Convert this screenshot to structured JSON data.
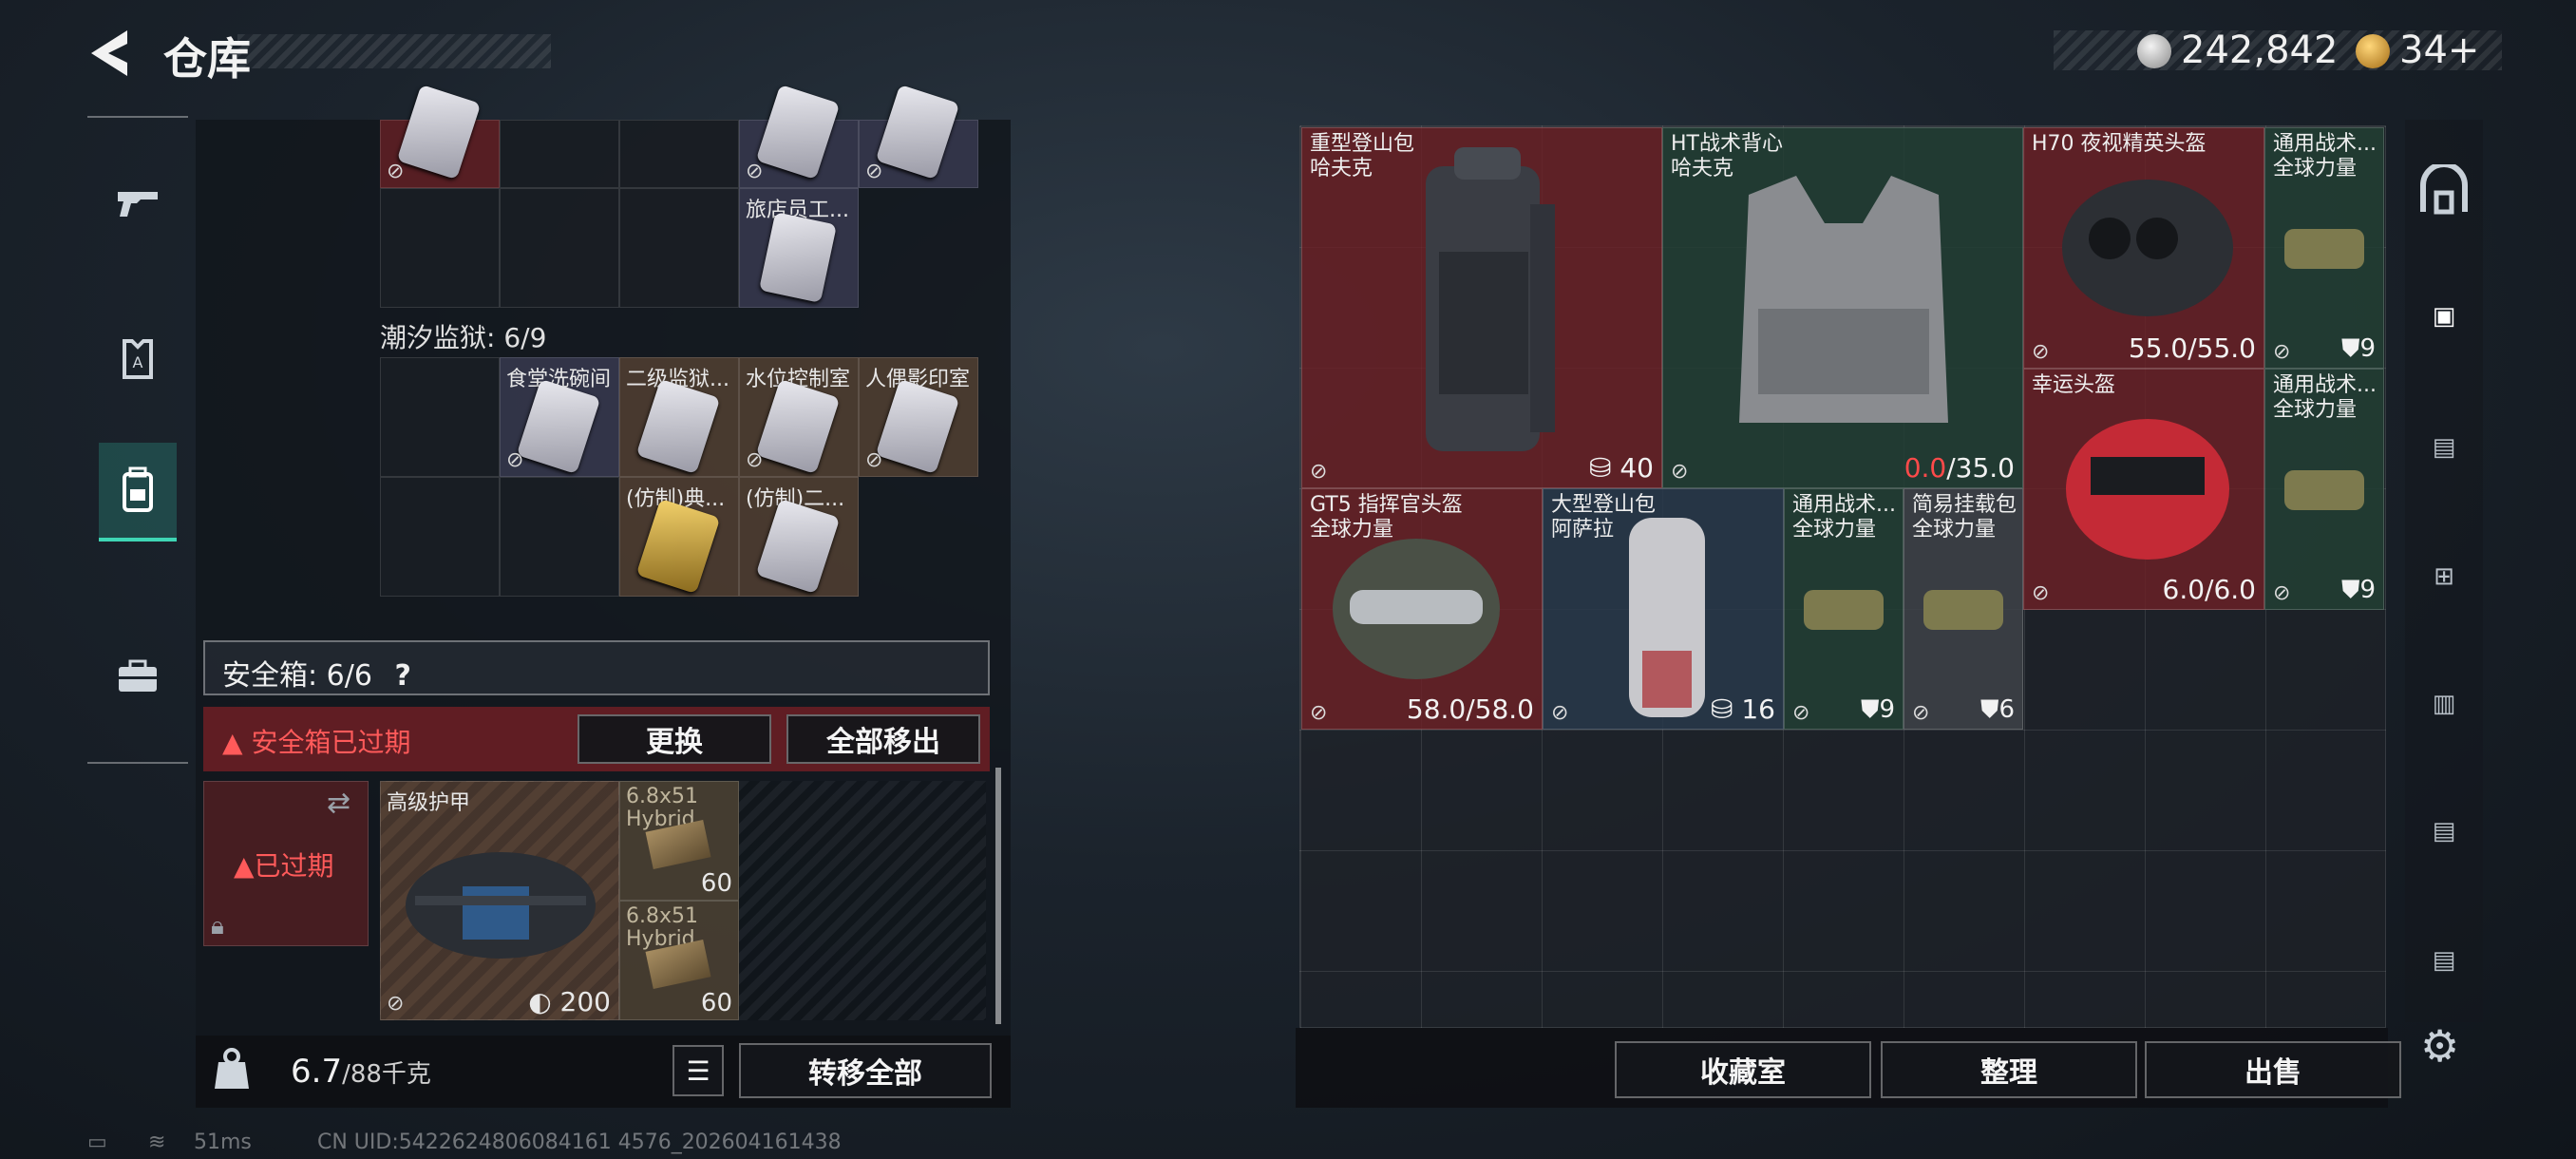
{
  "header": {
    "title": "仓库",
    "currency_silver": "242,842",
    "currency_gold": "34+"
  },
  "left_panel": {
    "top_row_items": [
      {
        "label": "旅店员工..."
      }
    ],
    "section_title": "潮汐监狱: 6/9",
    "keycards": [
      {
        "label": "食堂洗碗间"
      },
      {
        "label": "二级监狱..."
      },
      {
        "label": "水位控制室"
      },
      {
        "label": "人偶影印室"
      },
      {
        "label": "(仿制)典..."
      },
      {
        "label": "(仿制)二..."
      }
    ],
    "safebox_label": "安全箱: 6/6",
    "safebox_help": "?",
    "expired_warning": "安全箱已过期",
    "replace_button": "更换",
    "move_all_out_button": "全部移出",
    "expired_stamp": "已过期",
    "armor_label": "高级护甲",
    "armor_value": "200",
    "ammo": [
      {
        "label": "6.8x51 Hybrid",
        "count": "60"
      },
      {
        "label": "6.8x51 Hybrid",
        "count": "60"
      }
    ],
    "weight_current": "6.7",
    "weight_max": "/88千克",
    "transfer_all_button": "转移全部"
  },
  "stash": {
    "items": [
      {
        "name": "重型登山包",
        "sub": "哈夫克",
        "stat": "40"
      },
      {
        "name": "HT战术背心",
        "sub": "哈夫克",
        "stat_red": "0.0",
        "stat": "/35.0"
      },
      {
        "name": "H70 夜视精英头盔",
        "sub": "",
        "stat": "55.0/55.0"
      },
      {
        "name": "通用战术...",
        "sub": "全球力量",
        "stat": "9"
      },
      {
        "name": "幸运头盔",
        "sub": "",
        "stat": "6.0/6.0"
      },
      {
        "name": "通用战术...",
        "sub": "全球力量",
        "stat": "9"
      },
      {
        "name": "GT5 指挥官头盔",
        "sub": "全球力量",
        "stat": "58.0/58.0"
      },
      {
        "name": "大型登山包",
        "sub": "阿萨拉",
        "stat": "16"
      },
      {
        "name": "通用战术...",
        "sub": "全球力量",
        "stat": "9"
      },
      {
        "name": "简易挂载包",
        "sub": "全球力量",
        "stat": "6"
      }
    ],
    "collection_button": "收藏室",
    "sort_button": "整理",
    "sell_button": "出售"
  },
  "status_bar": {
    "ping": "51ms",
    "uid": "CN UID:5422624806084161 4576_202604161438"
  }
}
